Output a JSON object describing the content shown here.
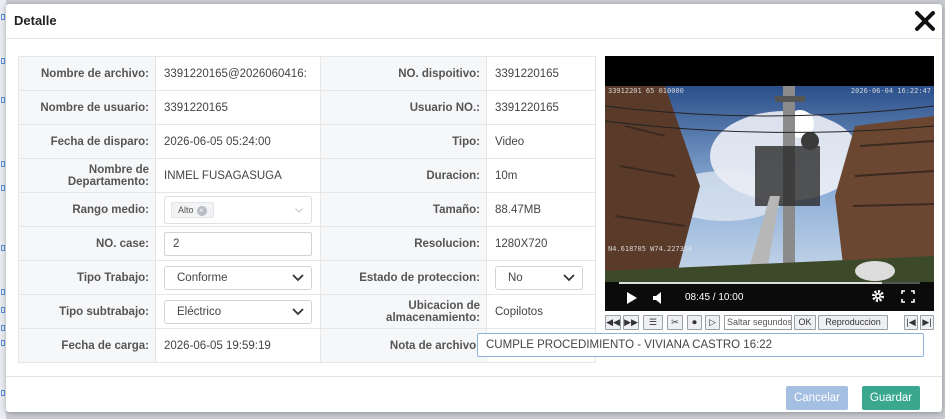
{
  "dialog": {
    "title": "Detalle"
  },
  "form": {
    "nombre_archivo": {
      "label": "Nombre de archivo:",
      "value": "3391220165@2026060416:"
    },
    "no_dispositivo": {
      "label": "NO. dispoitivo:",
      "value": "3391220165"
    },
    "nombre_usuario": {
      "label": "Nombre de usuario:",
      "value": "3391220165"
    },
    "usuario_no": {
      "label": "Usuario NO.:",
      "value": "3391220165"
    },
    "fecha_disparo": {
      "label": "Fecha de disparo:",
      "value": "2026-06-05 05:24:00"
    },
    "tipo": {
      "label": "Tipo:",
      "value": "Video"
    },
    "departamento": {
      "label": "Nombre de Departamento:",
      "value": "INMEL FUSAGASUGA"
    },
    "duracion": {
      "label": "Duracion:",
      "value": "10m"
    },
    "rango_medio": {
      "label": "Rango medio:",
      "tag": "Alto",
      "tag_remove": "×"
    },
    "tamano": {
      "label": "Tamaño:",
      "value": "88.47MB"
    },
    "no_case": {
      "label": "NO. case:",
      "value": "2"
    },
    "resolucion": {
      "label": "Resolucion:",
      "value": "1280X720"
    },
    "tipo_trabajo": {
      "label": "Tipo Trabajo:",
      "value": "Conforme"
    },
    "estado_proteccion": {
      "label": "Estado de proteccion:",
      "value": "No"
    },
    "tipo_subtrabajo": {
      "label": "Tipo subtrabajo:",
      "value": "Eléctrico"
    },
    "ubicacion": {
      "label": "Ubicacion de almacenamiento:",
      "value": "Copilotos"
    },
    "fecha_carga": {
      "label": "Fecha de carga:",
      "value": "2026-06-05 19:59:19"
    },
    "nota": {
      "label": "Nota de archivo:",
      "value": "CUMPLE PROCEDIMIENTO - VIVIANA CASTRO 16:22"
    }
  },
  "video": {
    "osd_top_left": "33912201 65 010000",
    "osd_top_right": "2026-06-04 16:22:47",
    "osd_bottom_left": "N4.618705  W74.227356",
    "time": "08:45 / 10:00",
    "progress": 0.875
  },
  "player_toolbar": {
    "buttons": [
      "◀◀",
      "▶▶",
      "☰",
      "✂",
      "⏺",
      "▷"
    ],
    "seek_placeholder": "Saltar segundos",
    "ok_label": "OK",
    "playback_label": "Reproduccion",
    "end_buttons": [
      "|◀",
      "▶|"
    ]
  },
  "footer": {
    "cancel_label": "Cancelar",
    "save_label": "Guardar"
  },
  "colors": {
    "cancel": "#a4bfe1",
    "save": "#3aa88f",
    "input_border_active": "#8fb2d9"
  }
}
